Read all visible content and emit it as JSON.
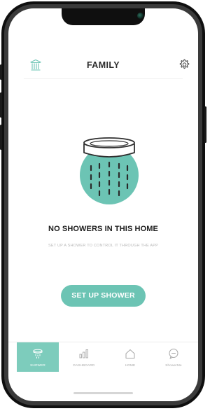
{
  "header": {
    "title": "FAMILY",
    "home_icon": "home-building-icon",
    "settings_icon": "gear-icon"
  },
  "empty_state": {
    "illustration_icon": "shower-head-icon",
    "title": "NO SHOWERS IN THIS HOME",
    "subtitle": "SET UP A SHOWER TO CONTROL IT THROUGH THE APP"
  },
  "primary_action": {
    "label": "SET UP SHOWER"
  },
  "tab_bar": {
    "active_tab": "SHOWER",
    "tabs": [
      {
        "label": "SHOWER",
        "icon": "shower-head-icon"
      },
      {
        "label": "DASHBOARD",
        "icon": "bar-chart-icon"
      },
      {
        "label": "HOME",
        "icon": "house-icon"
      },
      {
        "label": "ShowerMe",
        "icon": "chat-bubble-icon"
      }
    ]
  },
  "colors": {
    "accent": "#6cc4b4",
    "accent_tab": "#7dccbc",
    "phone_frame": "#0f0f0f",
    "text_dark": "#1d1d1d",
    "text_muted": "#b9b9b9"
  }
}
